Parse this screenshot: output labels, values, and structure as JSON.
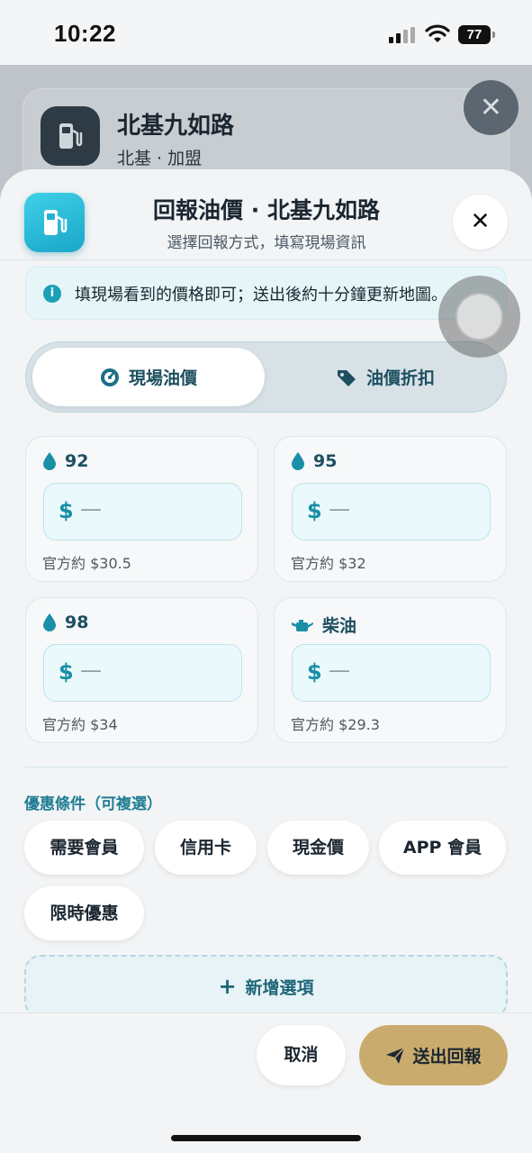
{
  "status_bar": {
    "time": "10:22",
    "battery": "77"
  },
  "background_card": {
    "title": "北基九如路",
    "subtitle": "北基 · 加盟"
  },
  "header": {
    "title": "回報油價 · 北基九如路",
    "subtitle": "選擇回報方式，填寫現場資訊"
  },
  "info_banner": {
    "text": "填現場看到的價格即可；送出後約十分鐘更新地圖。"
  },
  "tabs": [
    {
      "label": "現場油價",
      "icon": "gauge-icon",
      "active": true
    },
    {
      "label": "油價折扣",
      "icon": "tag-icon",
      "active": false
    }
  ],
  "fuel_cards": [
    {
      "label": "92",
      "icon": "drop-icon",
      "currency": "$",
      "value_placeholder": "—",
      "official": "官方約 $30.5"
    },
    {
      "label": "95",
      "icon": "drop-icon",
      "currency": "$",
      "value_placeholder": "—",
      "official": "官方約 $32"
    },
    {
      "label": "98",
      "icon": "drop-icon",
      "currency": "$",
      "value_placeholder": "—",
      "official": "官方約 $34"
    },
    {
      "label": "柴油",
      "icon": "oil-can-icon",
      "currency": "$",
      "value_placeholder": "—",
      "official": "官方約 $29.3"
    }
  ],
  "conditions": {
    "title": "優惠條件（可複選）",
    "chips": [
      "需要會員",
      "信用卡",
      "現金價",
      "APP 會員",
      "限時優惠"
    ],
    "add_label": "新增選項"
  },
  "footer": {
    "cancel": "取消",
    "submit": "送出回報"
  },
  "colors": {
    "accent": "#1ba0b8",
    "submit": "#c9ab6e",
    "tab_text": "#1d4f60"
  }
}
